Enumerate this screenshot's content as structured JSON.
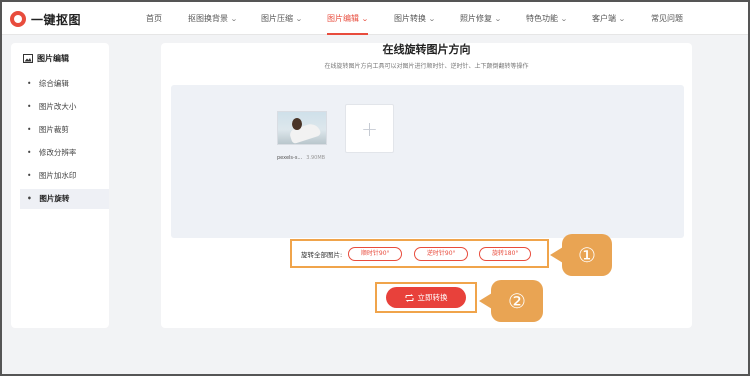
{
  "app": {
    "logo_text": "一键抠图"
  },
  "nav": [
    {
      "label": "首页",
      "has_dropdown": false,
      "active": false
    },
    {
      "label": "抠图换背景",
      "has_dropdown": true,
      "active": false
    },
    {
      "label": "图片压缩",
      "has_dropdown": true,
      "active": false
    },
    {
      "label": "图片编辑",
      "has_dropdown": true,
      "active": true
    },
    {
      "label": "图片转换",
      "has_dropdown": true,
      "active": false
    },
    {
      "label": "照片修复",
      "has_dropdown": true,
      "active": false
    },
    {
      "label": "特色功能",
      "has_dropdown": true,
      "active": false
    },
    {
      "label": "客户端",
      "has_dropdown": true,
      "active": false
    },
    {
      "label": "常见问题",
      "has_dropdown": false,
      "active": false
    }
  ],
  "sidebar": {
    "title": "图片编辑",
    "items": [
      {
        "label": "综合编辑",
        "active": false
      },
      {
        "label": "图片改大小",
        "active": false
      },
      {
        "label": "图片裁剪",
        "active": false
      },
      {
        "label": "修改分辨率",
        "active": false
      },
      {
        "label": "图片加水印",
        "active": false
      },
      {
        "label": "图片旋转",
        "active": true
      }
    ]
  },
  "main": {
    "title": "在线旋转图片方向",
    "subtitle": "在线旋转图片方向工具可以对图片进行顺时针、逆时针、上下颠倒翻转等操作",
    "file": {
      "name": "pexels-s...",
      "size": "3.90MB"
    },
    "rotate": {
      "label": "旋转全部图片:",
      "options": [
        "顺时针90°",
        "逆时针90°",
        "旋转180°"
      ]
    },
    "convert_label": "立即转换"
  },
  "callouts": [
    "①",
    "②"
  ],
  "colors": {
    "accent": "#e84c3d",
    "callout": "#e9a453",
    "highlight_border": "#f0a44b"
  }
}
